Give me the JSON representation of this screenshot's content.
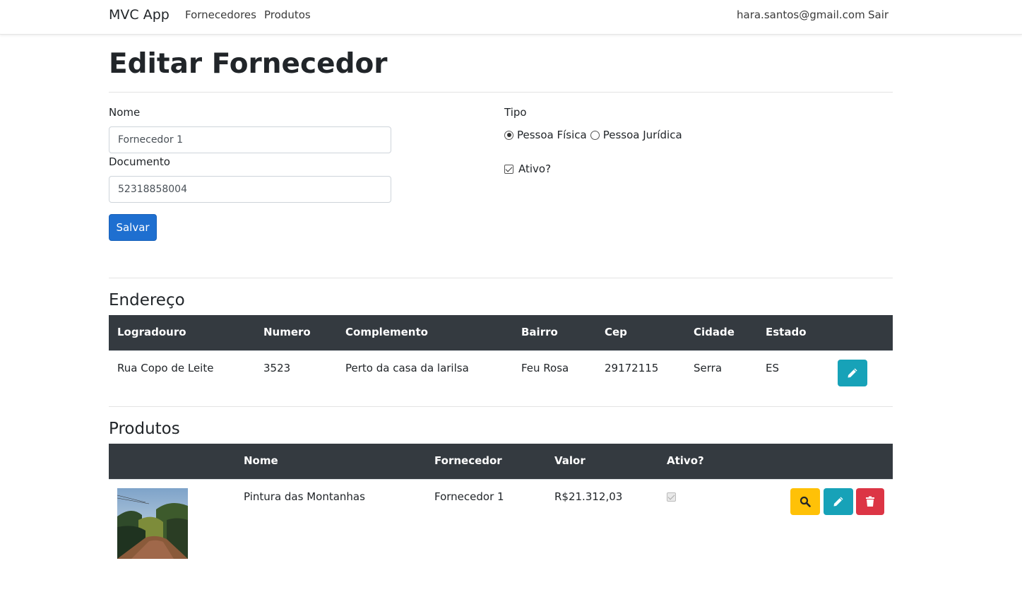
{
  "navbar": {
    "brand": "MVC App",
    "links": [
      "Fornecedores",
      "Produtos"
    ],
    "user_email": "hara.santos@gmail.com",
    "logout": "Sair"
  },
  "page_title": "Editar Fornecedor",
  "form": {
    "nome_label": "Nome",
    "nome_value": "Fornecedor 1",
    "documento_label": "Documento",
    "documento_value": "52318858004",
    "tipo_label": "Tipo",
    "tipo_options": [
      "Pessoa Física",
      "Pessoa Jurídica"
    ],
    "tipo_selected": "Pessoa Física",
    "ativo_label": "Ativo?",
    "ativo_checked": true,
    "save_label": "Salvar"
  },
  "endereco": {
    "title": "Endereço",
    "headers": [
      "Logradouro",
      "Numero",
      "Complemento",
      "Bairro",
      "Cep",
      "Cidade",
      "Estado"
    ],
    "row": [
      "Rua Copo de Leite",
      "3523",
      "Perto da casa da larilsa",
      "Feu Rosa",
      "29172115",
      "Serra",
      "ES"
    ]
  },
  "produtos": {
    "title": "Produtos",
    "headers": [
      "",
      "Nome",
      "Fornecedor",
      "Valor",
      "Ativo?"
    ],
    "row": {
      "nome": "Pintura das Montanhas",
      "fornecedor": "Fornecedor 1",
      "valor": "R$21.312,03",
      "ativo": true
    }
  },
  "colors": {
    "primary": "#1e6fd0",
    "info": "#17a2b8",
    "warning": "#ffc107",
    "danger": "#dc3545",
    "table_header": "#343a40"
  },
  "icons": [
    "pencil-icon",
    "search-icon",
    "trash-icon"
  ]
}
